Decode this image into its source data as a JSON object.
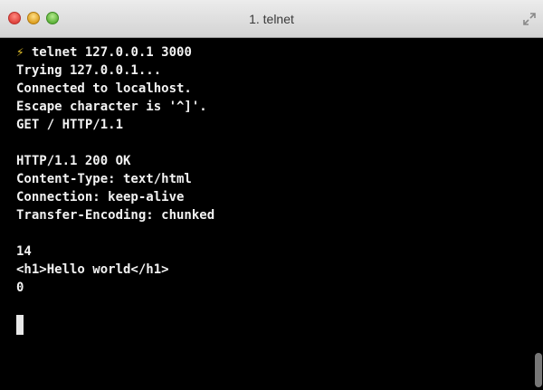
{
  "window": {
    "title": "1. telnet"
  },
  "terminal": {
    "prompt_icon": "⚡",
    "lines": [
      " telnet 127.0.0.1 3000",
      "Trying 127.0.0.1...",
      "Connected to localhost.",
      "Escape character is '^]'.",
      "GET / HTTP/1.1",
      "",
      "HTTP/1.1 200 OK",
      "Content-Type: text/html",
      "Connection: keep-alive",
      "Transfer-Encoding: chunked",
      "",
      "14",
      "<h1>Hello world</h1>",
      "0"
    ]
  }
}
